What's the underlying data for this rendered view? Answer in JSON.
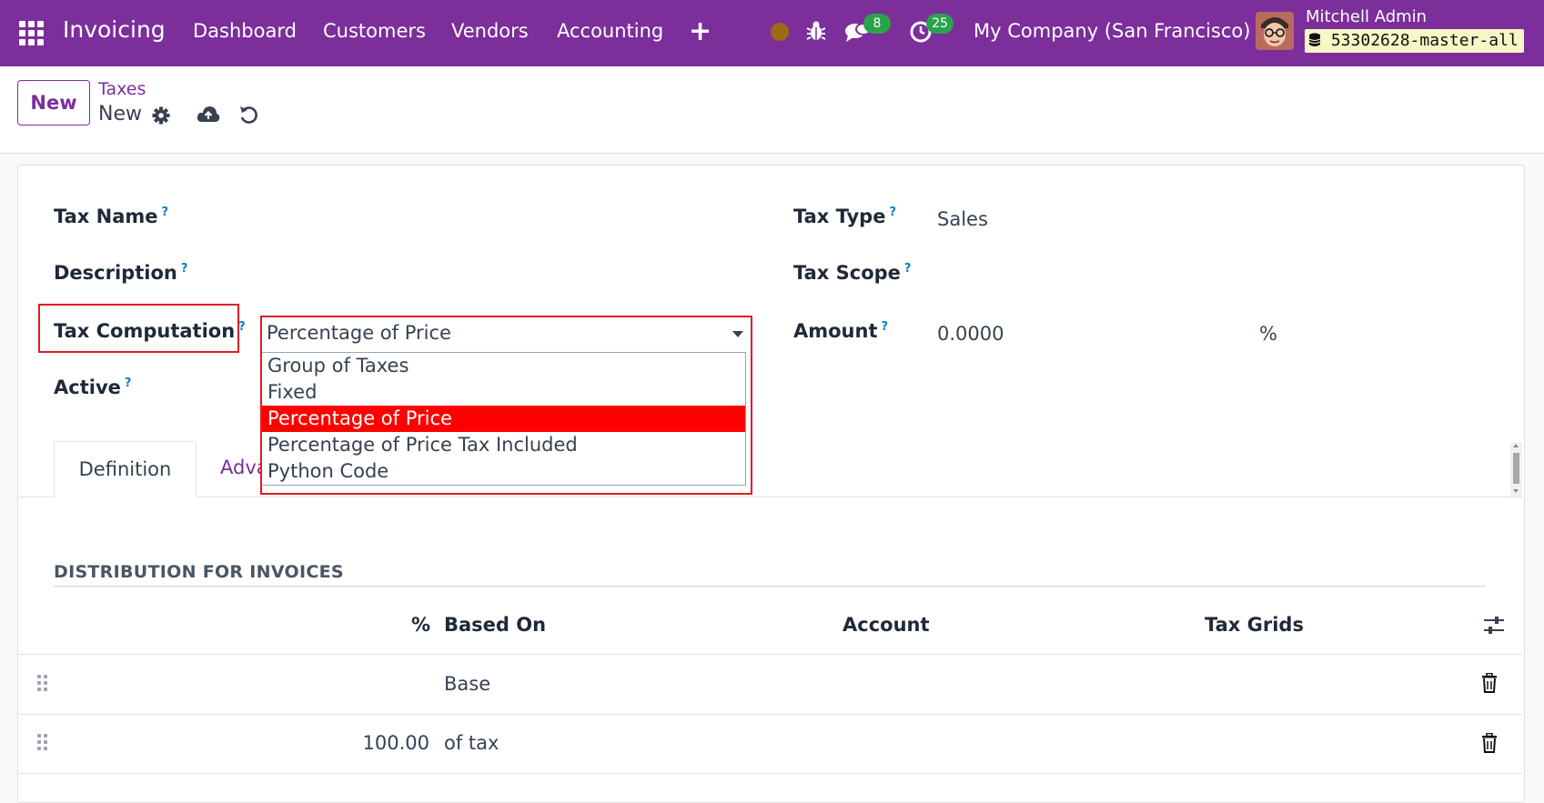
{
  "navbar": {
    "app_name": "Invoicing",
    "menu": [
      "Dashboard",
      "Customers",
      "Vendors",
      "Accounting"
    ],
    "messages_count": "8",
    "activities_count": "25",
    "company": "My Company (San Francisco)",
    "user_name": "Mitchell Admin",
    "database": "53302628-master-all",
    "colors": {
      "brand": "#7c2e9b",
      "badge": "#2aa34b"
    }
  },
  "control_panel": {
    "new_button": "New",
    "breadcrumb_parent": "Taxes",
    "breadcrumb_current": "New"
  },
  "form": {
    "labels": {
      "tax_name": "Tax Name",
      "description": "Description",
      "tax_computation": "Tax Computation",
      "active": "Active",
      "tax_type": "Tax Type",
      "tax_scope": "Tax Scope",
      "amount": "Amount"
    },
    "help_marker": "?",
    "tax_type_value": "Sales",
    "amount_value": "0.0000",
    "amount_unit": "%",
    "tax_computation": {
      "selected": "Percentage of Price",
      "options": [
        "Group of Taxes",
        "Fixed",
        "Percentage of Price",
        "Percentage of Price Tax Included",
        "Python Code"
      ],
      "highlight_color": "#ff0000"
    }
  },
  "tabs": {
    "definition": "Definition",
    "advanced_partial": "Adva"
  },
  "distribution": {
    "title": "DISTRIBUTION FOR INVOICES",
    "columns": {
      "percent": "%",
      "based_on": "Based On",
      "account": "Account",
      "tax_grids": "Tax Grids"
    },
    "rows": [
      {
        "percent": "",
        "based_on": "Base"
      },
      {
        "percent": "100.00",
        "based_on": "of tax"
      }
    ]
  }
}
